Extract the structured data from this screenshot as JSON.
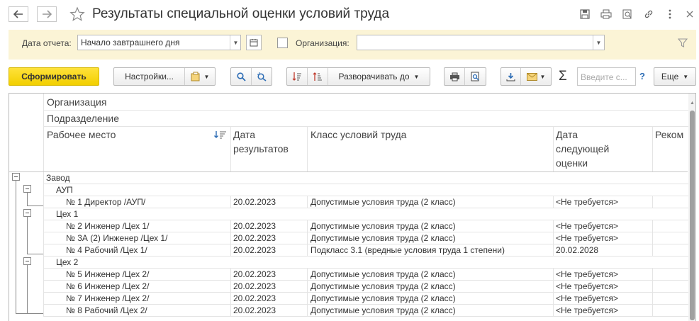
{
  "window": {
    "title": "Результаты специальной оценки условий труда"
  },
  "filters": {
    "date_label": "Дата отчета:",
    "date_value": "Начало завтрашнего дня",
    "org_label": "Организация:",
    "org_value": ""
  },
  "toolbar": {
    "generate": "Сформировать",
    "settings": "Настройки...",
    "expand": "Разворачивать до",
    "search_placeholder": "Введите с...",
    "help": "?",
    "more": "Еще",
    "sum": "Σ"
  },
  "grid": {
    "header": {
      "org": "Организация",
      "dept": "Подразделение",
      "workplace": "Рабочее место",
      "date": [
        "Дата",
        "результатов"
      ],
      "class": "Класс условий труда",
      "next": [
        "Дата",
        "следующей",
        "оценки"
      ],
      "rec": "Реком"
    },
    "rows": [
      {
        "level": 0,
        "name": "Завод",
        "date": "",
        "class": "",
        "next": ""
      },
      {
        "level": 1,
        "name": "АУП",
        "date": "",
        "class": "",
        "next": ""
      },
      {
        "level": 2,
        "name": "№ 1 Директор /АУП/",
        "date": "20.02.2023",
        "class": "Допустимые условия труда (2 класс)",
        "next": "<Не требуется>"
      },
      {
        "level": 1,
        "name": "Цех 1",
        "date": "",
        "class": "",
        "next": ""
      },
      {
        "level": 2,
        "name": "№ 2 Инженер /Цех 1/",
        "date": "20.02.2023",
        "class": "Допустимые условия труда (2 класс)",
        "next": "<Не требуется>"
      },
      {
        "level": 2,
        "name": "№ 3А (2) Инженер /Цех 1/",
        "date": "20.02.2023",
        "class": "Допустимые условия труда (2 класс)",
        "next": "<Не требуется>"
      },
      {
        "level": 2,
        "name": "№ 4 Рабочий /Цех 1/",
        "date": "20.02.2023",
        "class": "Подкласс 3.1 (вредные условия труда 1 степени)",
        "next": "20.02.2028"
      },
      {
        "level": 1,
        "name": "Цех 2",
        "date": "",
        "class": "",
        "next": ""
      },
      {
        "level": 2,
        "name": "№ 5 Инженер /Цех 2/",
        "date": "20.02.2023",
        "class": "Допустимые условия труда (2 класс)",
        "next": "<Не требуется>"
      },
      {
        "level": 2,
        "name": "№ 6 Инженер /Цех 2/",
        "date": "20.02.2023",
        "class": "Допустимые условия труда (2 класс)",
        "next": "<Не требуется>"
      },
      {
        "level": 2,
        "name": "№ 7 Инженер /Цех 2/",
        "date": "20.02.2023",
        "class": "Допустимые условия труда (2 класс)",
        "next": "<Не требуется>"
      },
      {
        "level": 2,
        "name": "№ 8 Рабочий /Цех 2/",
        "date": "20.02.2023",
        "class": "Допустимые условия труда (2 класс)",
        "next": "<Не требуется>"
      }
    ]
  },
  "colors": {
    "accent": "#f5d300",
    "filter_bg": "#fbf4d6",
    "blue_icon": "#2d6db5"
  }
}
